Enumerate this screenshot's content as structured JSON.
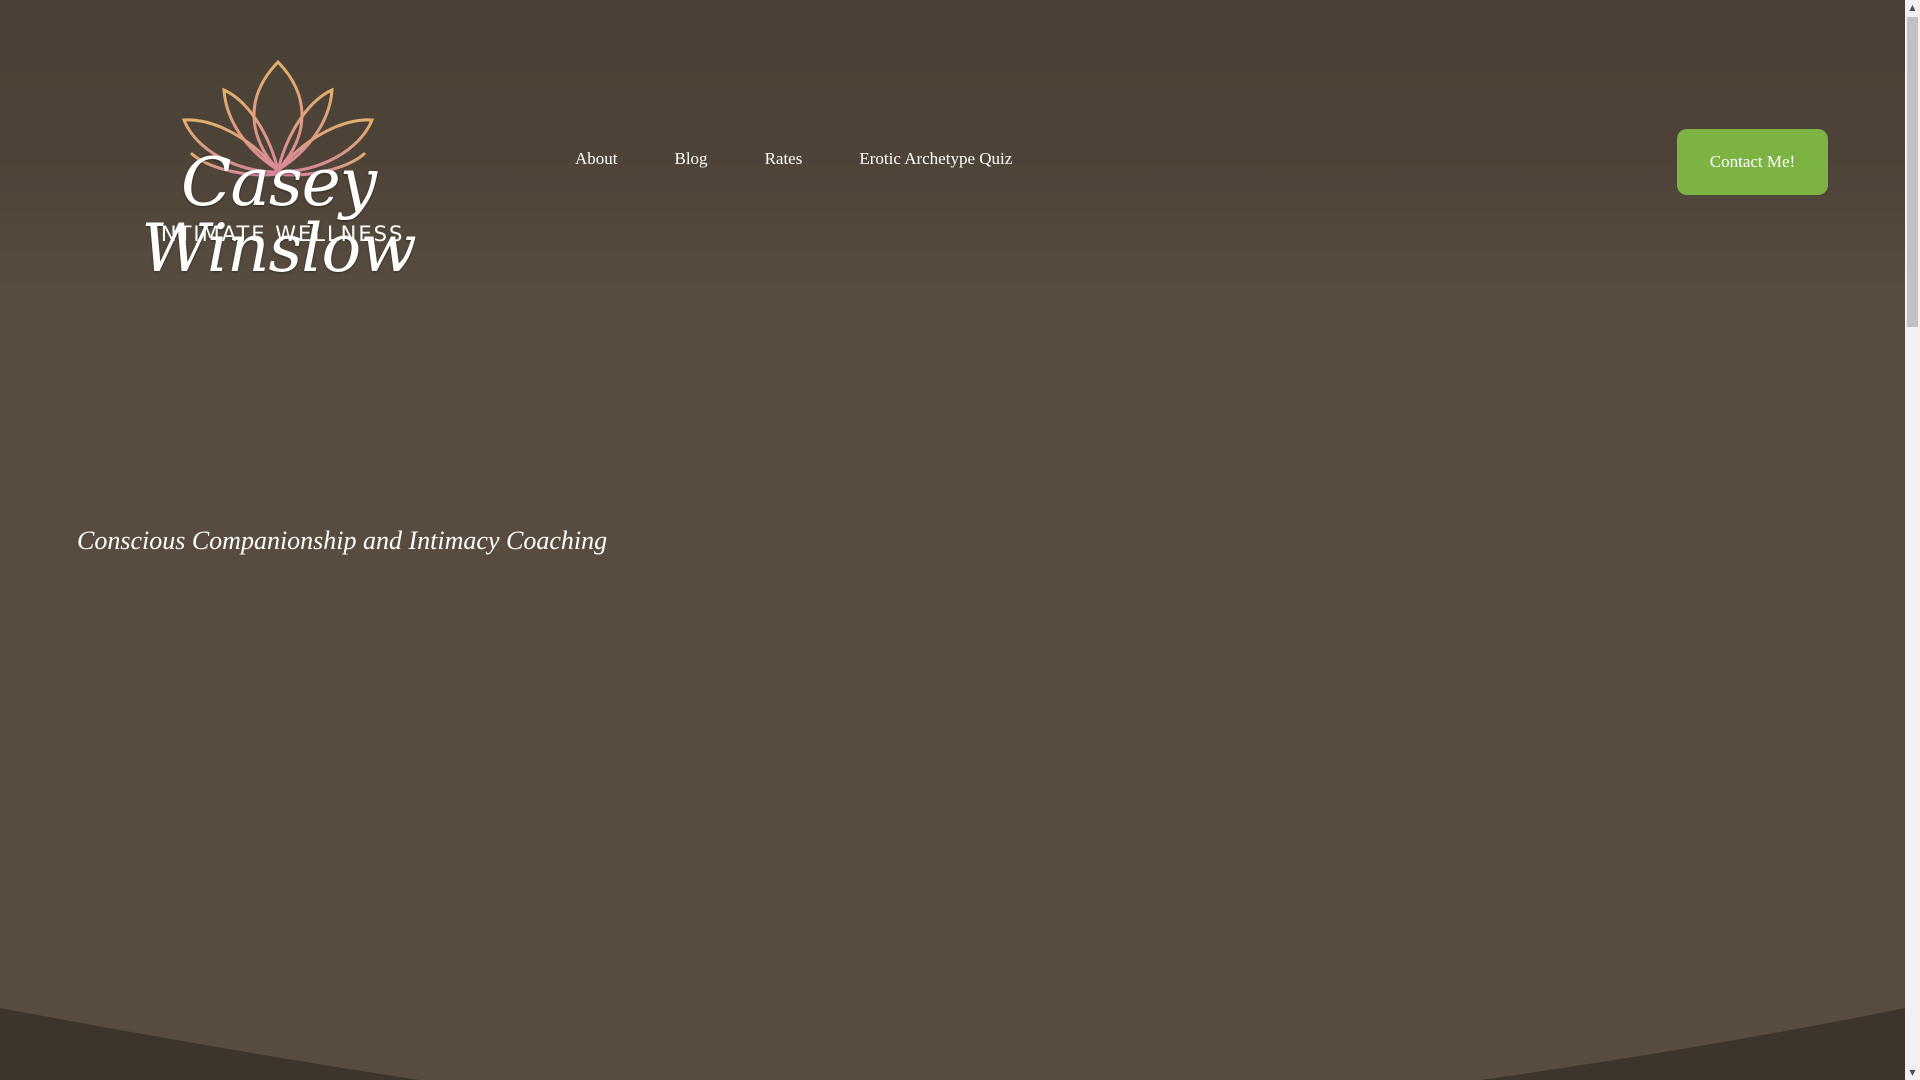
{
  "brand": {
    "logo_script": "Casey Winslow",
    "logo_subtitle": "INTIMATE WELLNESS",
    "logo_icon": "lotus-icon"
  },
  "nav": {
    "items": [
      {
        "label": "About"
      },
      {
        "label": "Blog"
      },
      {
        "label": "Rates"
      },
      {
        "label": "Erotic Archetype Quiz"
      }
    ]
  },
  "header": {
    "contact_label": "Contact Me!"
  },
  "hero": {
    "tagline": "Conscious Companionship and Intimacy Coaching"
  },
  "colors": {
    "background": "#574c3f",
    "header": "#4a4035",
    "accent_green": "#7cb342",
    "wave": "#3d352c",
    "lotus_gold": "#d9a767",
    "lotus_pink": "#d8879b"
  },
  "scrollbar": {
    "up_icon": "scroll-up-arrow-icon",
    "down_icon": "scroll-down-arrow-icon"
  }
}
